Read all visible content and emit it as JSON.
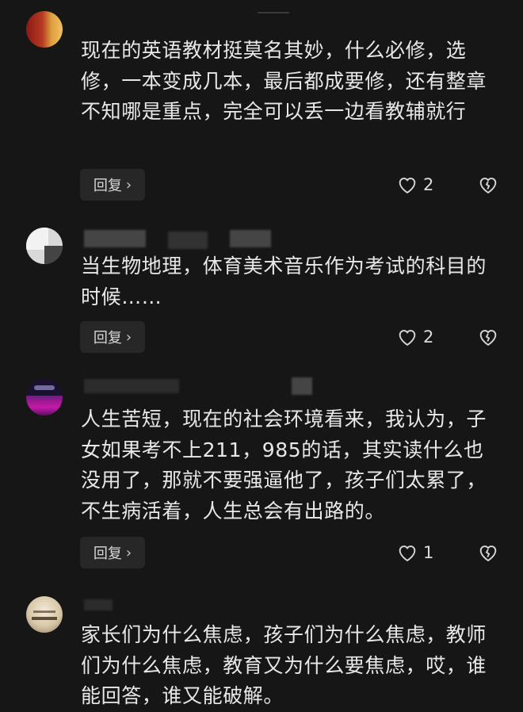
{
  "comments": [
    {
      "username": "",
      "text": "现在的英语教材挺莫名其妙，什么必修，选修，一本变成几本，最后都成要修，还有整章不知哪是重点，完全可以丢一边看教辅就行",
      "reply_label": "回复",
      "likes": "2"
    },
    {
      "username": "",
      "text": "当生物地理，体育美术音乐作为考试的科目的时候……",
      "reply_label": "回复",
      "likes": "2"
    },
    {
      "username": "",
      "text": "人生苦短，现在的社会环境看来，我认为，子女如果考不上211，985的话，其实读什么也没用了，那就不要强逼他了，孩子们太累了，不生病活着，人生总会有出路的。",
      "reply_label": "回复",
      "likes": "1"
    },
    {
      "username": "",
      "text": "家长们为什么焦虑，孩子们为什么焦虑，教师们为什么焦虑，教育又为什么要焦虑，哎，谁能回答，谁又能破解。"
    }
  ],
  "icons": {
    "like": "heart-outline-icon",
    "dislike": "broken-heart-icon",
    "reply_chevron": "chevron-right-icon"
  },
  "colors": {
    "background": "#161616",
    "text": "#e8e8e8",
    "button_bg": "#272727"
  }
}
